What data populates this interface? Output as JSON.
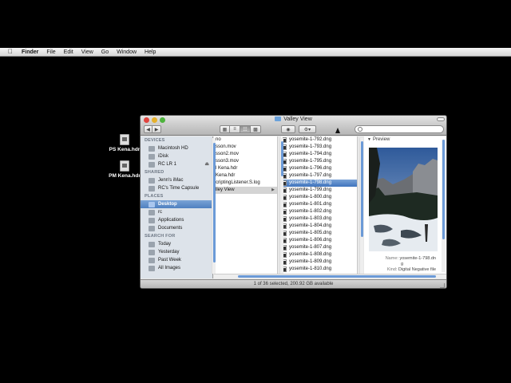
{
  "menubar": {
    "app": "Finder",
    "items": [
      "File",
      "Edit",
      "View",
      "Go",
      "Window",
      "Help"
    ]
  },
  "desktop_icons": [
    {
      "label": "PS Kena.hdr"
    },
    {
      "label": "PM Kena.hdr"
    }
  ],
  "window": {
    "title": "Valley View",
    "search_placeholder": "",
    "status": "1 of 36 selected, 200.92 GB available"
  },
  "sidebar": {
    "devices_header": "DEVICES",
    "devices": [
      {
        "label": "Macintosh HD",
        "icon": "hard-drive-icon"
      },
      {
        "label": "iDisk",
        "icon": "idisk-icon"
      },
      {
        "label": "RC LR 1",
        "icon": "external-drive-icon"
      }
    ],
    "shared_header": "SHARED",
    "shared": [
      {
        "label": "Jenn's iMac",
        "icon": "imac-icon"
      },
      {
        "label": "RC's Time Capsule",
        "icon": "time-capsule-icon"
      }
    ],
    "places_header": "PLACES",
    "places": [
      {
        "label": "Desktop",
        "icon": "desktop-icon",
        "selected": true
      },
      {
        "label": "rc",
        "icon": "home-icon"
      },
      {
        "label": "Applications",
        "icon": "applications-icon"
      },
      {
        "label": "Documents",
        "icon": "documents-icon"
      }
    ],
    "search_header": "SEARCH FOR",
    "search": [
      {
        "label": "Today",
        "icon": "clock-icon"
      },
      {
        "label": "Yesterday",
        "icon": "clock-icon"
      },
      {
        "label": "Past Week",
        "icon": "clock-icon"
      },
      {
        "label": "All Images",
        "icon": "images-icon"
      }
    ]
  },
  "column1": [
    {
      "label": "no"
    },
    {
      "label": "sson.mov"
    },
    {
      "label": "sson2.mov"
    },
    {
      "label": "sson3.mov"
    },
    {
      "label": "l Kena.hdr"
    },
    {
      "label": "Kena.hdr"
    },
    {
      "label": "criptingListener.S.log"
    },
    {
      "label": "lley View",
      "selected": true
    }
  ],
  "column2": [
    {
      "label": "yosemite-1-792.dng"
    },
    {
      "label": "yosemite-1-793.dng"
    },
    {
      "label": "yosemite-1-794.dng"
    },
    {
      "label": "yosemite-1-795.dng"
    },
    {
      "label": "yosemite-1-796.dng"
    },
    {
      "label": "yosemite-1-797.dng"
    },
    {
      "label": "yosemite-1-798.dng",
      "selected": true
    },
    {
      "label": "yosemite-1-799.dng"
    },
    {
      "label": "yosemite-1-800.dng"
    },
    {
      "label": "yosemite-1-801.dng"
    },
    {
      "label": "yosemite-1-802.dng"
    },
    {
      "label": "yosemite-1-803.dng"
    },
    {
      "label": "yosemite-1-804.dng"
    },
    {
      "label": "yosemite-1-805.dng"
    },
    {
      "label": "yosemite-1-806.dng"
    },
    {
      "label": "yosemite-1-807.dng"
    },
    {
      "label": "yosemite-1-808.dng"
    },
    {
      "label": "yosemite-1-809.dng"
    },
    {
      "label": "yosemite-1-810.dng"
    }
  ],
  "preview": {
    "header": "Preview",
    "name_key": "Name",
    "name_value": "yosemite-1-798.dn",
    "name_value_2": "g",
    "kind_key": "Kind",
    "kind_value": "Digital Negative file"
  },
  "colors": {
    "selection": "#4f80c0",
    "sidebar_bg": "#dde3ea",
    "desktop": "#000000"
  }
}
